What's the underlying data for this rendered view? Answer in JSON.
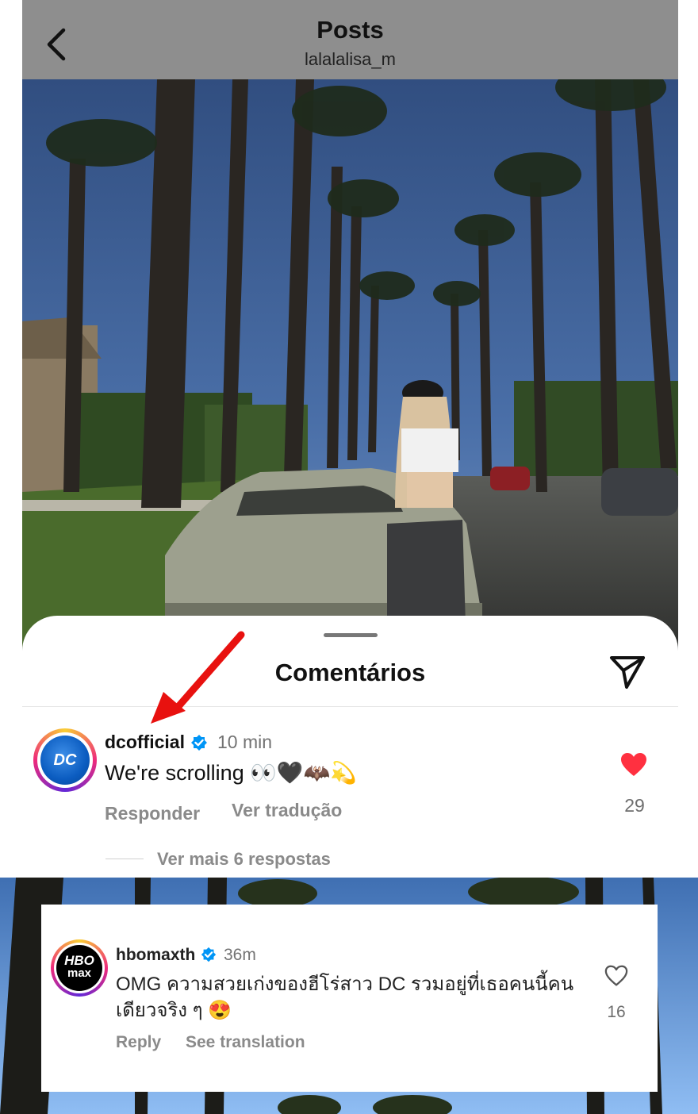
{
  "header": {
    "title": "Posts",
    "username": "lalalalisa_m"
  },
  "comments_sheet": {
    "title": "Comentários"
  },
  "comment_1": {
    "avatar_text": "DC",
    "username": "dcofficial",
    "time": "10 min",
    "text": "We're scrolling 👀🖤🦇💫",
    "reply_label": "Responder",
    "translate_label": "Ver tradução",
    "likes": "29",
    "liked": true,
    "more_replies": "Ver mais 6 respostas"
  },
  "comment_2": {
    "avatar_text_line1": "HBO",
    "avatar_text_line2": "max",
    "username": "hbomaxth",
    "time": "36m",
    "text": "OMG ความสวยเก่งของฮีโร่สาว DC รวมอยู่ที่เธอคนนี้คนเดียวจริง ๆ 😍",
    "reply_label": "Reply",
    "translate_label": "See translation",
    "likes": "16",
    "liked": false
  },
  "colors": {
    "like_red": "#ff3040",
    "verified_blue": "#0095f6",
    "annotation_arrow": "#e8110f",
    "sky": "#4a78b5"
  }
}
